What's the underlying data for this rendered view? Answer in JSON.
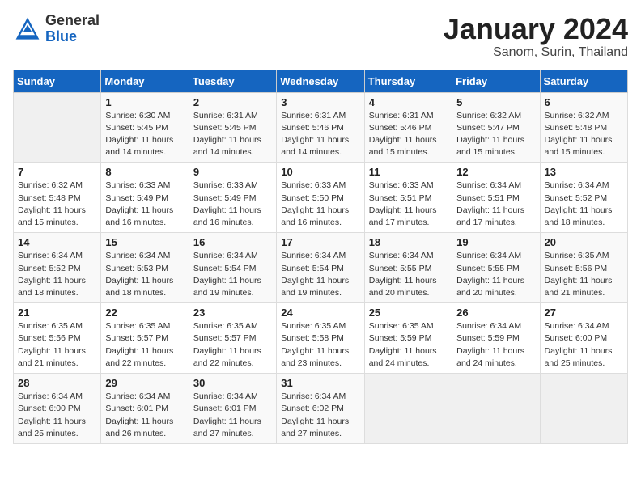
{
  "header": {
    "logo_general": "General",
    "logo_blue": "Blue",
    "month": "January 2024",
    "location": "Sanom, Surin, Thailand"
  },
  "days_of_week": [
    "Sunday",
    "Monday",
    "Tuesday",
    "Wednesday",
    "Thursday",
    "Friday",
    "Saturday"
  ],
  "weeks": [
    [
      {
        "day": "",
        "detail": ""
      },
      {
        "day": "1",
        "detail": "Sunrise: 6:30 AM\nSunset: 5:45 PM\nDaylight: 11 hours\nand 14 minutes."
      },
      {
        "day": "2",
        "detail": "Sunrise: 6:31 AM\nSunset: 5:45 PM\nDaylight: 11 hours\nand 14 minutes."
      },
      {
        "day": "3",
        "detail": "Sunrise: 6:31 AM\nSunset: 5:46 PM\nDaylight: 11 hours\nand 14 minutes."
      },
      {
        "day": "4",
        "detail": "Sunrise: 6:31 AM\nSunset: 5:46 PM\nDaylight: 11 hours\nand 15 minutes."
      },
      {
        "day": "5",
        "detail": "Sunrise: 6:32 AM\nSunset: 5:47 PM\nDaylight: 11 hours\nand 15 minutes."
      },
      {
        "day": "6",
        "detail": "Sunrise: 6:32 AM\nSunset: 5:48 PM\nDaylight: 11 hours\nand 15 minutes."
      }
    ],
    [
      {
        "day": "7",
        "detail": "Sunrise: 6:32 AM\nSunset: 5:48 PM\nDaylight: 11 hours\nand 15 minutes."
      },
      {
        "day": "8",
        "detail": "Sunrise: 6:33 AM\nSunset: 5:49 PM\nDaylight: 11 hours\nand 16 minutes."
      },
      {
        "day": "9",
        "detail": "Sunrise: 6:33 AM\nSunset: 5:49 PM\nDaylight: 11 hours\nand 16 minutes."
      },
      {
        "day": "10",
        "detail": "Sunrise: 6:33 AM\nSunset: 5:50 PM\nDaylight: 11 hours\nand 16 minutes."
      },
      {
        "day": "11",
        "detail": "Sunrise: 6:33 AM\nSunset: 5:51 PM\nDaylight: 11 hours\nand 17 minutes."
      },
      {
        "day": "12",
        "detail": "Sunrise: 6:34 AM\nSunset: 5:51 PM\nDaylight: 11 hours\nand 17 minutes."
      },
      {
        "day": "13",
        "detail": "Sunrise: 6:34 AM\nSunset: 5:52 PM\nDaylight: 11 hours\nand 18 minutes."
      }
    ],
    [
      {
        "day": "14",
        "detail": "Sunrise: 6:34 AM\nSunset: 5:52 PM\nDaylight: 11 hours\nand 18 minutes."
      },
      {
        "day": "15",
        "detail": "Sunrise: 6:34 AM\nSunset: 5:53 PM\nDaylight: 11 hours\nand 18 minutes."
      },
      {
        "day": "16",
        "detail": "Sunrise: 6:34 AM\nSunset: 5:54 PM\nDaylight: 11 hours\nand 19 minutes."
      },
      {
        "day": "17",
        "detail": "Sunrise: 6:34 AM\nSunset: 5:54 PM\nDaylight: 11 hours\nand 19 minutes."
      },
      {
        "day": "18",
        "detail": "Sunrise: 6:34 AM\nSunset: 5:55 PM\nDaylight: 11 hours\nand 20 minutes."
      },
      {
        "day": "19",
        "detail": "Sunrise: 6:34 AM\nSunset: 5:55 PM\nDaylight: 11 hours\nand 20 minutes."
      },
      {
        "day": "20",
        "detail": "Sunrise: 6:35 AM\nSunset: 5:56 PM\nDaylight: 11 hours\nand 21 minutes."
      }
    ],
    [
      {
        "day": "21",
        "detail": "Sunrise: 6:35 AM\nSunset: 5:56 PM\nDaylight: 11 hours\nand 21 minutes."
      },
      {
        "day": "22",
        "detail": "Sunrise: 6:35 AM\nSunset: 5:57 PM\nDaylight: 11 hours\nand 22 minutes."
      },
      {
        "day": "23",
        "detail": "Sunrise: 6:35 AM\nSunset: 5:57 PM\nDaylight: 11 hours\nand 22 minutes."
      },
      {
        "day": "24",
        "detail": "Sunrise: 6:35 AM\nSunset: 5:58 PM\nDaylight: 11 hours\nand 23 minutes."
      },
      {
        "day": "25",
        "detail": "Sunrise: 6:35 AM\nSunset: 5:59 PM\nDaylight: 11 hours\nand 24 minutes."
      },
      {
        "day": "26",
        "detail": "Sunrise: 6:34 AM\nSunset: 5:59 PM\nDaylight: 11 hours\nand 24 minutes."
      },
      {
        "day": "27",
        "detail": "Sunrise: 6:34 AM\nSunset: 6:00 PM\nDaylight: 11 hours\nand 25 minutes."
      }
    ],
    [
      {
        "day": "28",
        "detail": "Sunrise: 6:34 AM\nSunset: 6:00 PM\nDaylight: 11 hours\nand 25 minutes."
      },
      {
        "day": "29",
        "detail": "Sunrise: 6:34 AM\nSunset: 6:01 PM\nDaylight: 11 hours\nand 26 minutes."
      },
      {
        "day": "30",
        "detail": "Sunrise: 6:34 AM\nSunset: 6:01 PM\nDaylight: 11 hours\nand 27 minutes."
      },
      {
        "day": "31",
        "detail": "Sunrise: 6:34 AM\nSunset: 6:02 PM\nDaylight: 11 hours\nand 27 minutes."
      },
      {
        "day": "",
        "detail": ""
      },
      {
        "day": "",
        "detail": ""
      },
      {
        "day": "",
        "detail": ""
      }
    ]
  ]
}
